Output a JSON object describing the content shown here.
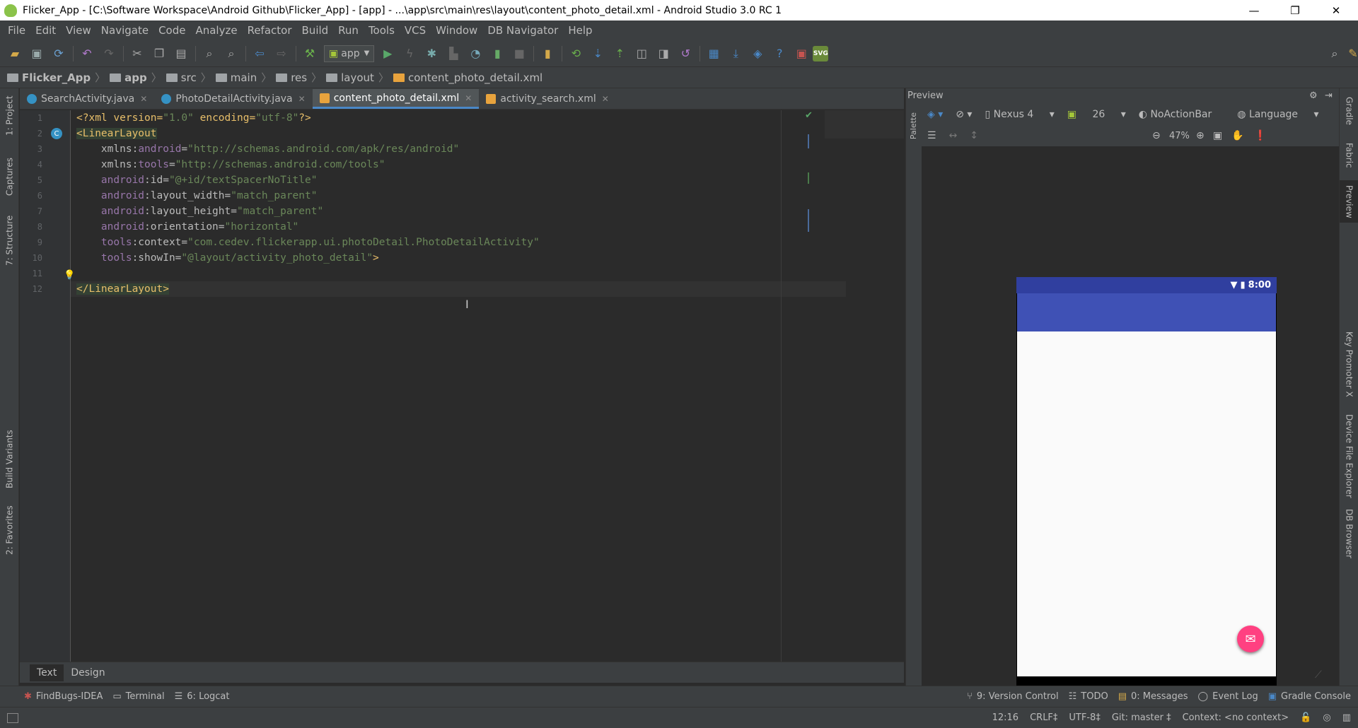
{
  "window": {
    "title": "Flicker_App - [C:\\Software Workspace\\Android Github\\Flicker_App] - [app] - ...\\app\\src\\main\\res\\layout\\content_photo_detail.xml - Android Studio 3.0 RC 1",
    "minimize": "—",
    "restore": "❐",
    "close": "✕"
  },
  "menu": [
    "File",
    "Edit",
    "View",
    "Navigate",
    "Code",
    "Analyze",
    "Refactor",
    "Build",
    "Run",
    "Tools",
    "VCS",
    "Window",
    "DB Navigator",
    "Help"
  ],
  "toolbar": {
    "run_config": "app"
  },
  "breadcrumb": [
    "Flicker_App",
    "app",
    "src",
    "main",
    "res",
    "layout",
    "content_photo_detail.xml"
  ],
  "editor_tabs": [
    {
      "label": "SearchActivity.java",
      "active": false
    },
    {
      "label": "PhotoDetailActivity.java",
      "active": false
    },
    {
      "label": "content_photo_detail.xml",
      "active": true
    },
    {
      "label": "activity_search.xml",
      "active": false
    }
  ],
  "left_tools": [
    "1: Project",
    "Captures",
    "7: Structure",
    "Build Variants",
    "2: Favorites"
  ],
  "right_tools": [
    "Gradle",
    "Fabric",
    "Preview",
    "Key Promoter X",
    "Device File Explorer",
    "DB Browser"
  ],
  "code_lines": [
    {
      "n": "1",
      "parts": [
        [
          "pi",
          "<?xml version="
        ],
        [
          "val",
          "\"1.0\""
        ],
        [
          "pi",
          " encoding="
        ],
        [
          "val",
          "\"utf-8\""
        ],
        [
          "pi",
          "?>"
        ]
      ]
    },
    {
      "n": "2",
      "parts": [
        [
          "tag",
          "<LinearLayout"
        ]
      ]
    },
    {
      "n": "3",
      "parts": [
        [
          "attr",
          "    xmlns:"
        ],
        [
          "ns",
          "android"
        ],
        [
          "attr",
          "="
        ],
        [
          "val",
          "\"http://schemas.android.com/apk/res/android\""
        ]
      ]
    },
    {
      "n": "4",
      "parts": [
        [
          "attr",
          "    xmlns:"
        ],
        [
          "ns",
          "tools"
        ],
        [
          "attr",
          "="
        ],
        [
          "val",
          "\"http://schemas.android.com/tools\""
        ]
      ]
    },
    {
      "n": "5",
      "parts": [
        [
          "ns",
          "    android"
        ],
        [
          "attr",
          ":id="
        ],
        [
          "val",
          "\"@+id/textSpacerNoTitle\""
        ]
      ]
    },
    {
      "n": "6",
      "parts": [
        [
          "ns",
          "    android"
        ],
        [
          "attr",
          ":layout_width="
        ],
        [
          "val",
          "\"match_parent\""
        ]
      ]
    },
    {
      "n": "7",
      "parts": [
        [
          "ns",
          "    android"
        ],
        [
          "attr",
          ":layout_height="
        ],
        [
          "val",
          "\"match_parent\""
        ]
      ]
    },
    {
      "n": "8",
      "parts": [
        [
          "ns",
          "    android"
        ],
        [
          "attr",
          ":orientation="
        ],
        [
          "val",
          "\"horizontal\""
        ]
      ]
    },
    {
      "n": "9",
      "parts": [
        [
          "ns",
          "    tools"
        ],
        [
          "attr",
          ":context="
        ],
        [
          "val",
          "\"com.cedev.flickerapp.ui.photoDetail.PhotoDetailActivity\""
        ]
      ]
    },
    {
      "n": "10",
      "parts": [
        [
          "ns",
          "    tools"
        ],
        [
          "attr",
          ":showIn="
        ],
        [
          "val",
          "\"@layout/activity_photo_detail\""
        ],
        [
          "tag",
          ">"
        ]
      ]
    },
    {
      "n": "11",
      "parts": []
    },
    {
      "n": "12",
      "parts": [
        [
          "tag",
          "</LinearLayout>"
        ]
      ]
    }
  ],
  "editor_bottom_tabs": [
    "Text",
    "Design"
  ],
  "preview": {
    "title": "Preview",
    "palette_label": "Palette",
    "device": "Nexus 4",
    "api": "26",
    "theme": "NoActionBar",
    "language": "Language",
    "zoom": "47%",
    "phone_time": "8:00"
  },
  "tool_windows_left": [
    {
      "icon": "bug",
      "label": "FindBugs-IDEA"
    },
    {
      "icon": "terminal",
      "label": "Terminal"
    },
    {
      "icon": "logcat",
      "label": "6: Logcat"
    }
  ],
  "tool_windows_right": [
    {
      "icon": "vcs",
      "label": "9: Version Control"
    },
    {
      "icon": "todo",
      "label": "TODO"
    },
    {
      "icon": "messages",
      "label": "0: Messages"
    },
    {
      "icon": "eventlog",
      "label": "Event Log"
    },
    {
      "icon": "gradle",
      "label": "Gradle Console"
    }
  ],
  "status": {
    "position": "12:16",
    "line_sep": "CRLF‡",
    "encoding": "UTF-8‡",
    "git": "Git: master ‡",
    "context": "Context: <no context>"
  },
  "colors": {
    "accent": "#4a88c7",
    "app_bar": "#3f51b5",
    "status_bar": "#303f9f",
    "fab": "#ff4081"
  }
}
